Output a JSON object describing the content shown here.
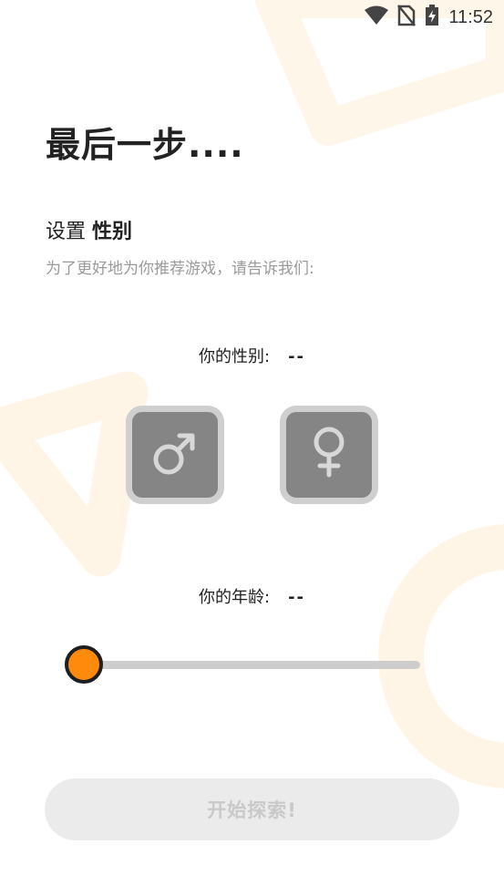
{
  "status_bar": {
    "time": "11:52",
    "icons": [
      "wifi-icon",
      "no-sim-icon",
      "battery-charging-icon"
    ]
  },
  "title": "最后一步....",
  "section": {
    "prefix": "设置",
    "emphasis": "性别",
    "subtitle": "为了更好地为你推荐游戏，请告诉我们:"
  },
  "gender": {
    "label": "你的性别:",
    "value": "--",
    "options": [
      {
        "icon": "male-icon",
        "selected": false
      },
      {
        "icon": "female-icon",
        "selected": false
      }
    ]
  },
  "age": {
    "label": "你的年龄:",
    "value": "--",
    "slider_fraction": 0
  },
  "start_button": {
    "label": "开始探索!",
    "enabled": false
  },
  "colors": {
    "accent": "#ff8a0c",
    "button_gray": "#858585",
    "track": "#cdcdcd",
    "disabled_bg": "#ebebeb",
    "disabled_text": "#c9c9c9",
    "subtitle": "#9a9a9a"
  }
}
